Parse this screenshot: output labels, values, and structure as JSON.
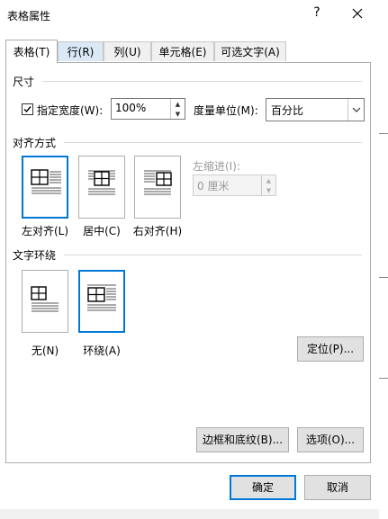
{
  "window": {
    "title": "表格属性",
    "help_label": "?"
  },
  "tabs": [
    {
      "label": "表格(T)"
    },
    {
      "label": "行(R)"
    },
    {
      "label": "列(U)"
    },
    {
      "label": "单元格(E)"
    },
    {
      "label": "可选文字(A)"
    }
  ],
  "size": {
    "heading": "尺寸",
    "width_checkbox_label": "指定宽度(W):",
    "width_value": "100%",
    "unit_label": "度量单位(M):",
    "unit_value": "百分比"
  },
  "alignment": {
    "heading": "对齐方式",
    "options": [
      {
        "label": "左对齐(L)",
        "selected": true
      },
      {
        "label": "居中(C)",
        "selected": false
      },
      {
        "label": "右对齐(H)",
        "selected": false
      }
    ],
    "indent_label": "左缩进(I):",
    "indent_value": "0 厘米"
  },
  "wrapping": {
    "heading": "文字环绕",
    "options": [
      {
        "label": "无(N)",
        "selected": false
      },
      {
        "label": "环绕(A)",
        "selected": true
      }
    ],
    "position_button": "定位(P)..."
  },
  "buttons": {
    "borders": "边框和底纹(B)...",
    "options": "选项(O)...",
    "ok": "确定",
    "cancel": "取消"
  },
  "colors": {
    "accent": "#0078d7",
    "panel_border": "#adadad"
  }
}
